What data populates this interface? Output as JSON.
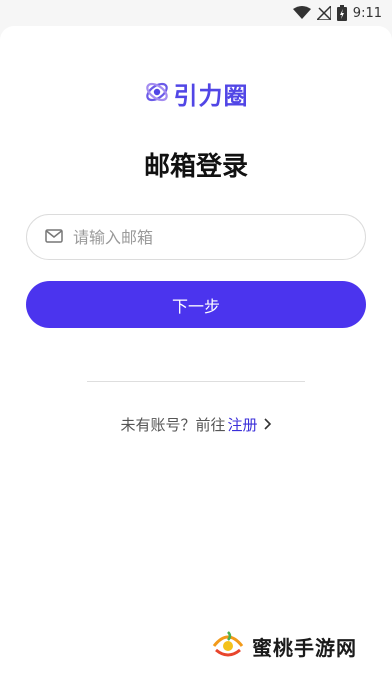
{
  "status_bar": {
    "time": "9:11"
  },
  "logo": {
    "text": "引力圈"
  },
  "page": {
    "title": "邮箱登录"
  },
  "email": {
    "placeholder": "请输入邮箱",
    "value": ""
  },
  "next_button": {
    "label": "下一步"
  },
  "register": {
    "prompt": "未有账号？前往",
    "link_label": "注册"
  },
  "watermark": {
    "text": "蜜桃手游网"
  },
  "colors": {
    "accent": "#4b34ee",
    "link": "#3b2fd9",
    "logo": "#5146e6"
  }
}
